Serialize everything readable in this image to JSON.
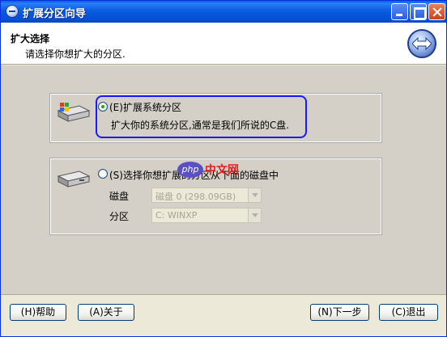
{
  "window": {
    "title": "扩展分区向导"
  },
  "header": {
    "title": "扩大选择",
    "subtitle": "请选择你想扩大的分区."
  },
  "option1": {
    "label": "(E)扩展系统分区",
    "description": "扩大你的系统分区,通常是我们所说的C盘.",
    "selected": true
  },
  "option2": {
    "label": "(S)选择你想扩展的分区从下面的磁盘中",
    "selected": false,
    "disk_label": "磁盘",
    "disk_value": "磁盘 0 (298.09GB)",
    "partition_label": "分区",
    "partition_value": "C: WINXP"
  },
  "watermark": {
    "badge": "php",
    "text": "中文网"
  },
  "footer": {
    "help_label": "(H)帮助",
    "about_label": "(A)关于",
    "next_label": "(N)下一步",
    "cancel_label": "(C)退出"
  },
  "colors": {
    "title_bar": "#0a5ae8",
    "highlight_border": "#1a1aff",
    "radio_selected": "#21a121"
  },
  "icons": [
    "wizard-app-icon",
    "minimize-icon",
    "maximize-icon",
    "close-icon",
    "resize-arrows-icon",
    "system-drive-icon",
    "disk-drive-icon"
  ]
}
